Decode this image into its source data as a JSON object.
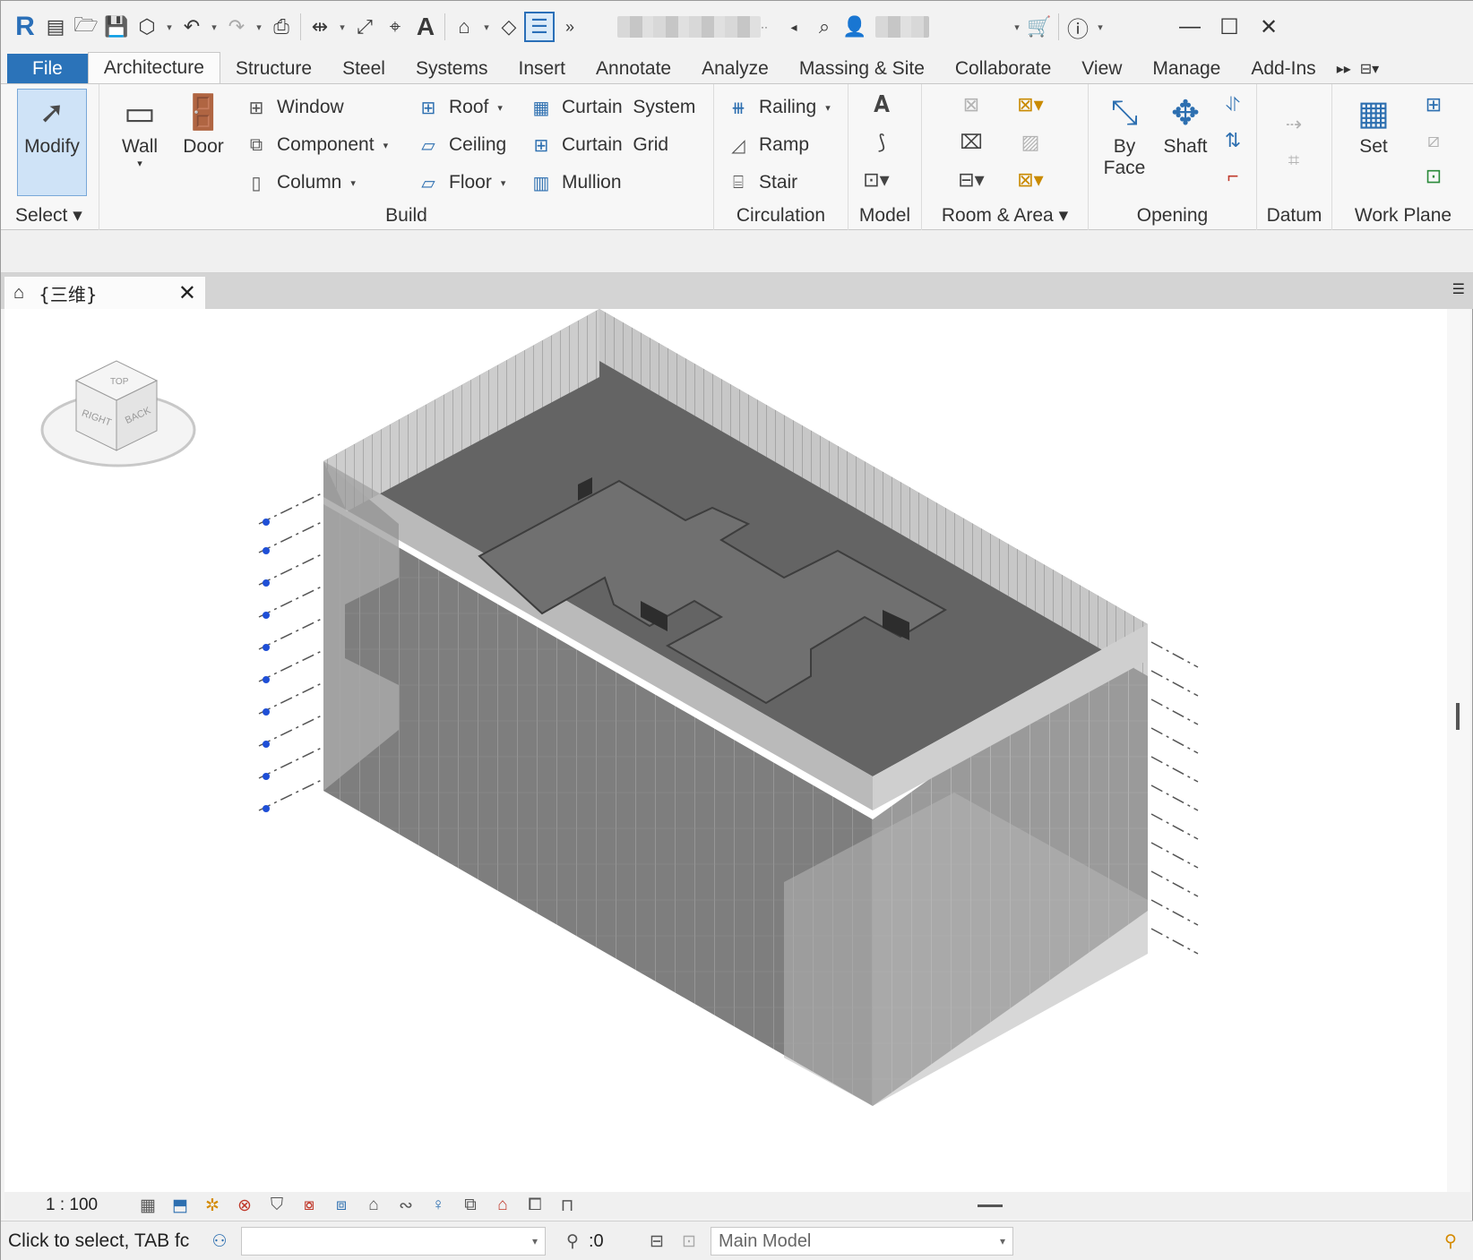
{
  "app": {
    "logo": "R"
  },
  "quick_access": {
    "icons": [
      "open-icon",
      "save-icon",
      "sync-icon",
      "undo-icon",
      "redo-icon",
      "print-icon",
      "measure-icon",
      "dimension-icon",
      "tag-icon",
      "text-icon",
      "3d-view-icon",
      "section-icon",
      "thin-lines-icon",
      "more-icon"
    ],
    "search_placeholder": ""
  },
  "window_controls": {
    "minimize": "—",
    "maximize": "☐",
    "close": "✕"
  },
  "ribbon_tabs": [
    "File",
    "Architecture",
    "Structure",
    "Steel",
    "Systems",
    "Insert",
    "Annotate",
    "Analyze",
    "Massing & Site",
    "Collaborate",
    "View",
    "Manage",
    "Add-Ins"
  ],
  "active_tab": "Architecture",
  "panels": {
    "select": {
      "title": "Select",
      "modify": "Modify"
    },
    "build": {
      "title": "Build",
      "wall": "Wall",
      "door": "Door",
      "window": "Window",
      "component": "Component",
      "column": "Column",
      "roof": "Roof",
      "ceiling": "Ceiling",
      "floor": "Floor",
      "curtain_system": "Curtain  System",
      "curtain_grid": "Curtain  Grid",
      "mullion": "Mullion"
    },
    "circulation": {
      "title": "Circulation",
      "railing": "Railing",
      "ramp": "Ramp",
      "stair": "Stair"
    },
    "model": {
      "title": "Model"
    },
    "room_area": {
      "title": "Room & Area"
    },
    "opening": {
      "title": "Opening",
      "by_face_1": "By",
      "by_face_2": "Face",
      "shaft": "Shaft"
    },
    "datum": {
      "title": "Datum"
    },
    "work_plane": {
      "title": "Work Plane",
      "set": "Set"
    }
  },
  "view_tab": {
    "label": "{三维}"
  },
  "viewcube": {
    "top": "TOP",
    "right": "RIGHT",
    "back": "BACK"
  },
  "view_control": {
    "scale": "1 : 100"
  },
  "status": {
    "text": "Click to select, TAB fc",
    "count": ":0",
    "model": "Main Model"
  },
  "colors": {
    "file_tab": "#2b73b9",
    "modify_bg": "#cfe3f7",
    "level_marker": "#1f4fd6"
  }
}
